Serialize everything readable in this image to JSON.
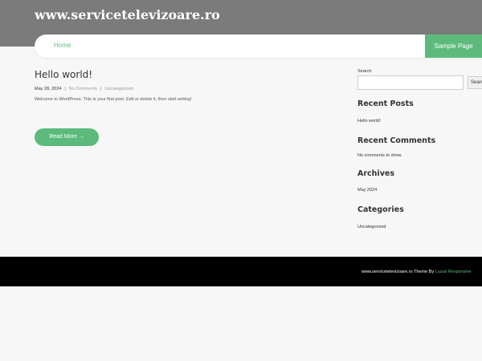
{
  "header": {
    "site_title": "www.servicetelevizoare.ro"
  },
  "nav": {
    "home": "Home",
    "sample_page": "Sample Page"
  },
  "post": {
    "title": "Hello world!",
    "date": "May 28, 2024",
    "comments": "No Comments",
    "category": "Uncategorized",
    "separator": "|",
    "excerpt": "Welcome to WordPress. This is your first post. Edit or delete it, then start writing!",
    "read_more": "Read More →"
  },
  "sidebar": {
    "search_label": "Search",
    "search_value": "",
    "search_button": "Search",
    "recent_posts_title": "Recent Posts",
    "recent_post_1": "Hello world!",
    "recent_comments_title": "Recent Comments",
    "no_comments": "No comments to show.",
    "archives_title": "Archives",
    "archive_1": "May 2024",
    "categories_title": "Categories",
    "category_1": "Uncategorized"
  },
  "footer": {
    "text": "www.servicetelevizoare.ro Theme By ",
    "link": "Luzuk Responsive"
  },
  "colors": {
    "accent": "#5cbb7c",
    "header_bg": "#7b7b7b",
    "footer_bg": "#000000"
  }
}
